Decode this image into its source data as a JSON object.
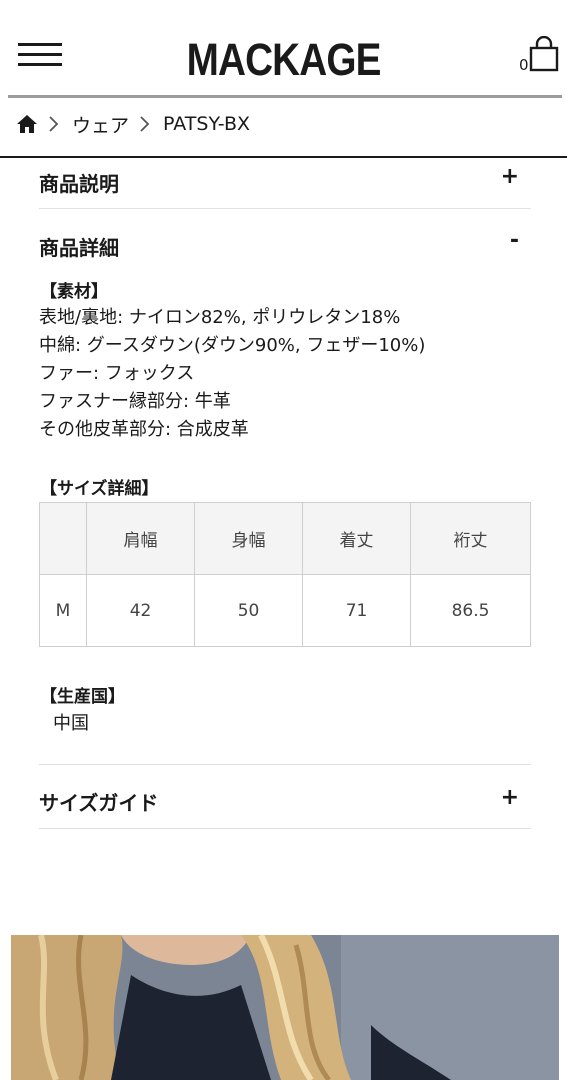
{
  "header": {
    "logo": "MACKAGE",
    "cart_count": "0"
  },
  "breadcrumb": [
    {
      "label": "ウェア"
    },
    {
      "label": "PATSY-BX"
    }
  ],
  "accordion": {
    "description": {
      "title": "商品説明",
      "sign": "+"
    },
    "details": {
      "title": "商品詳細",
      "sign": "-"
    },
    "size_guide": {
      "title": "サイズガイド",
      "sign": "+"
    }
  },
  "material": {
    "label": "【素材】",
    "lines": [
      "表地/裏地: ナイロン82%, ポリウレタン18%",
      "中綿: グースダウン(ダウン90%, フェザー10%)",
      "ファー: フォックス",
      "ファスナー縁部分: 牛革",
      "その他皮革部分: 合成皮革"
    ]
  },
  "size_details": {
    "label": "【サイズ詳細】",
    "headers": [
      "",
      "肩幅",
      "身幅",
      "着丈",
      "裄丈"
    ],
    "rows": [
      [
        "M",
        "42",
        "50",
        "71",
        "86.5"
      ]
    ]
  },
  "origin": {
    "label": "【生産国】",
    "value": "中国"
  },
  "colors": {
    "text": "#1a1a1a",
    "table_header_bg": "#f4f4f4",
    "table_border": "#cfcfcf",
    "divider": "#e2e2e2",
    "photo_bg": "#7c8594",
    "hair": "#c9a774"
  },
  "icons": {
    "menu": "hamburger-menu-icon",
    "cart": "shopping-bag-icon",
    "home": "home-icon",
    "separator": "chevron-right-icon"
  }
}
